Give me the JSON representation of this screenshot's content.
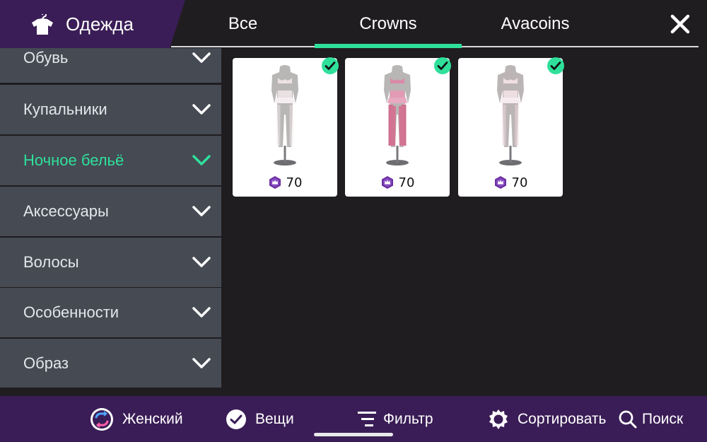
{
  "header": {
    "title": "Одежда",
    "tabs": [
      {
        "label": "Все"
      },
      {
        "label": "Crowns"
      },
      {
        "label": "Avacoins"
      }
    ],
    "active_tab": "Crowns",
    "accent_color": "#2fe09b",
    "brand_color": "#3a1d56"
  },
  "sidebar": {
    "items": [
      {
        "label": "Обувь"
      },
      {
        "label": "Купальники"
      },
      {
        "label": "Ночное бельё"
      },
      {
        "label": "Аксессуары"
      },
      {
        "label": "Волосы"
      },
      {
        "label": "Особенности"
      },
      {
        "label": "Образ"
      }
    ],
    "active_item": "Ночное бельё"
  },
  "items": [
    {
      "price": "70",
      "currency_icon": "crown-coin-icon",
      "owned": true
    },
    {
      "price": "70",
      "currency_icon": "crown-coin-icon",
      "owned": true
    },
    {
      "price": "70",
      "currency_icon": "crown-coin-icon",
      "owned": true
    }
  ],
  "bottom_bar": {
    "gender": "Женский",
    "things": "Вещи",
    "filter": "Фильтр",
    "sort": "Сортировать",
    "search": "Поиск"
  }
}
